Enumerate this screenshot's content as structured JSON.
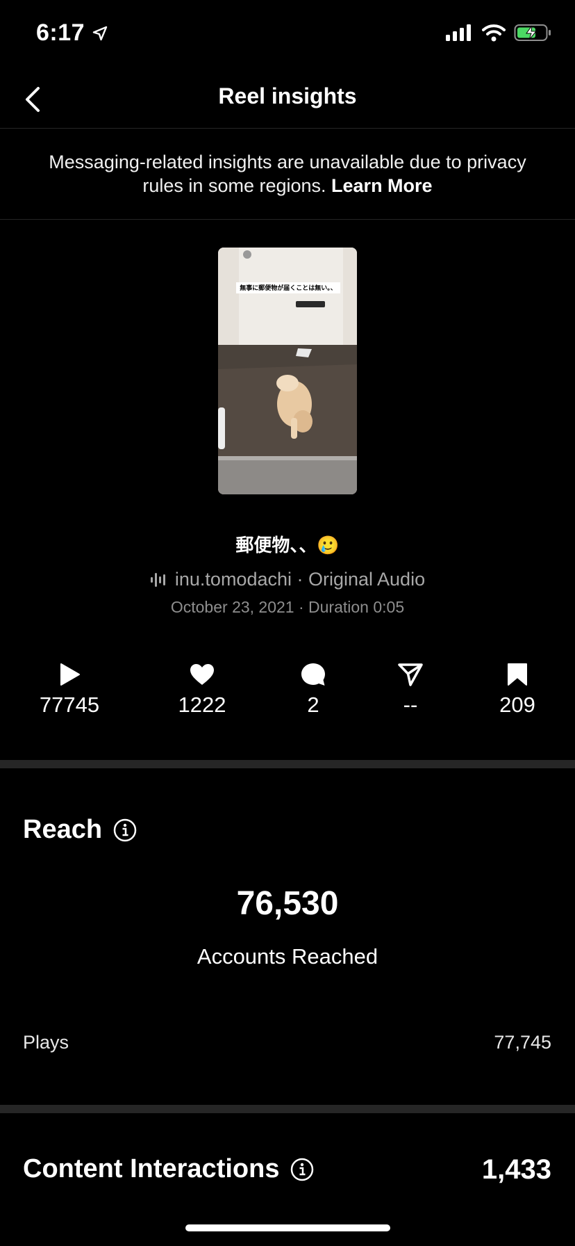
{
  "status_bar": {
    "time": "6:17"
  },
  "nav": {
    "title": "Reel insights"
  },
  "notice": {
    "text": "Messaging-related insights are unavailable due to privacy rules in some regions. ",
    "link": "Learn More"
  },
  "reel": {
    "thumbnail_caption": "無事に郵便物が届くことは無い。、",
    "caption": "郵便物、、🥲",
    "audio": "inu.tomodachi · Original Audio",
    "meta": "October 23, 2021 · Duration 0:05"
  },
  "stats": [
    {
      "icon": "play-icon",
      "value": "77745"
    },
    {
      "icon": "heart-icon",
      "value": "1222"
    },
    {
      "icon": "comment-icon",
      "value": "2"
    },
    {
      "icon": "share-icon",
      "value": "--"
    },
    {
      "icon": "bookmark-icon",
      "value": "209"
    }
  ],
  "reach": {
    "title": "Reach",
    "number": "76,530",
    "label": "Accounts Reached",
    "plays_label": "Plays",
    "plays_value": "77,745"
  },
  "content_interactions": {
    "title": "Content Interactions",
    "value": "1,433"
  },
  "colors": {
    "background": "#000000",
    "divider": "#262626",
    "battery": "#4cd964"
  }
}
